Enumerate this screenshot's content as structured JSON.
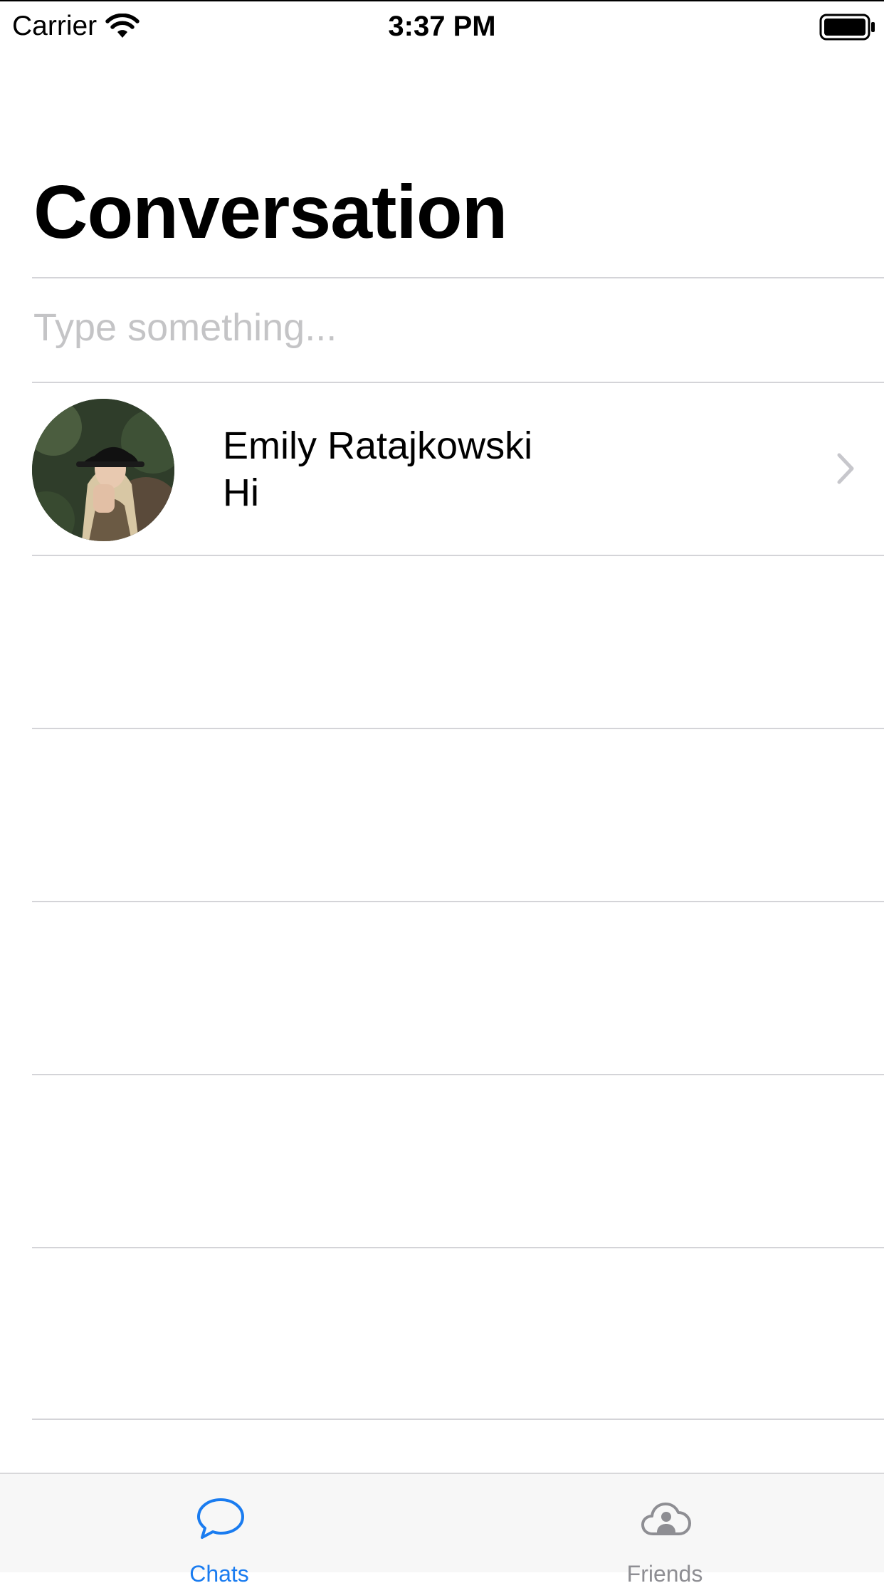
{
  "status_bar": {
    "carrier": "Carrier",
    "time": "3:37 PM",
    "wifi_icon": "wifi-icon",
    "battery_icon": "battery-full-icon"
  },
  "header": {
    "title": "Conversation"
  },
  "search": {
    "placeholder": "Type something...",
    "value": ""
  },
  "conversations": [
    {
      "name": "Emily Ratajkowski",
      "last_message": "Hi",
      "avatar_icon": "avatar-photo",
      "accessory_icon": "chevron-right-icon"
    }
  ],
  "tab_bar": {
    "tabs": [
      {
        "label": "Chats",
        "icon": "chat-bubble-icon",
        "selected": true
      },
      {
        "label": "Friends",
        "icon": "cloud-person-icon",
        "selected": false
      }
    ]
  },
  "colors": {
    "accent": "#1a7cf0",
    "inactive": "#8e8e93",
    "separator": "#d4d4d8",
    "placeholder": "#c4c4c6",
    "tab_bar_background": "#f7f7f7"
  }
}
